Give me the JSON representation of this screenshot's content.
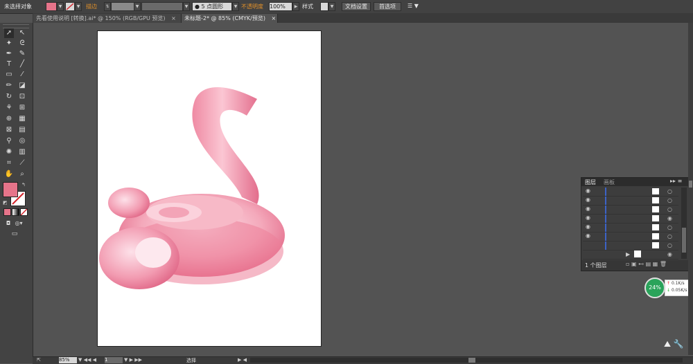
{
  "control": {
    "selection_status": "未选择对象",
    "stroke_label": "描边",
    "stroke_weight": "5 点圆形",
    "opacity_label": "不透明度",
    "opacity_value": "100%",
    "style_label": "样式",
    "doc_setup": "文档设置",
    "preferences": "首选项"
  },
  "tabs": [
    {
      "label": "先看使用说明 [转换].ai* @ 150% (RGB/GPU 预览)",
      "close": "×"
    },
    {
      "label": "未标题-2* @ 85% (CMYK/预览)",
      "close": "×"
    }
  ],
  "layers_panel": {
    "tab_layers": "图层",
    "tab_artboards": "画板",
    "count": "1 个图层"
  },
  "status": {
    "zoom": "85%",
    "page": "1",
    "tool": "选择"
  },
  "network": {
    "percent": "24%",
    "up": "0.1K/s",
    "down": "0.05K/s"
  },
  "colors": {
    "fill": "#e6748a",
    "pink": "#f08aa2",
    "panel_bg": "#535353"
  }
}
